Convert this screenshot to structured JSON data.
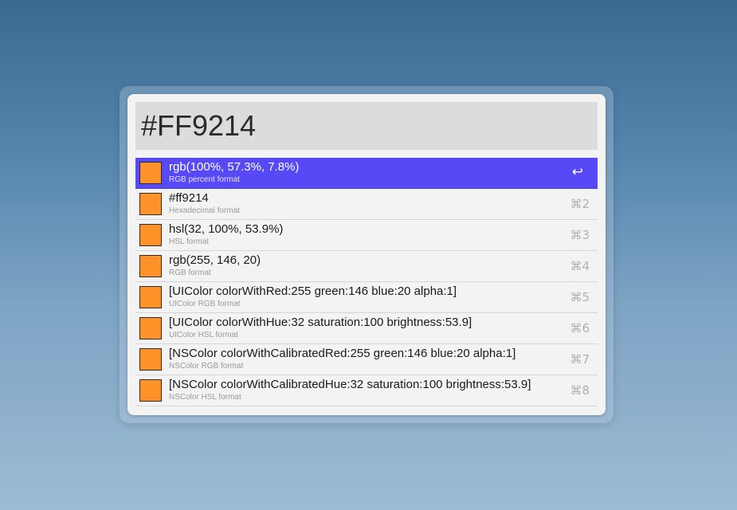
{
  "query": {
    "value": "#FF9214"
  },
  "colors": {
    "swatch": "#ff9229",
    "selection": "#5749f6"
  },
  "results": [
    {
      "title": "rgb(100%, 57.3%, 7.8%)",
      "subtitle": "RGB percent format",
      "shortcut": "↩",
      "selected": true
    },
    {
      "title": "#ff9214",
      "subtitle": "Hexadecimal format",
      "shortcut": "⌘2",
      "selected": false
    },
    {
      "title": "hsl(32, 100%, 53.9%)",
      "subtitle": "HSL format",
      "shortcut": "⌘3",
      "selected": false
    },
    {
      "title": "rgb(255, 146, 20)",
      "subtitle": "RGB format",
      "shortcut": "⌘4",
      "selected": false
    },
    {
      "title": "[UIColor colorWithRed:255 green:146 blue:20 alpha:1]",
      "subtitle": "UIColor RGB format",
      "shortcut": "⌘5",
      "selected": false
    },
    {
      "title": "[UIColor colorWithHue:32 saturation:100 brightness:53.9]",
      "subtitle": "UIColor HSL format",
      "shortcut": "⌘6",
      "selected": false
    },
    {
      "title": "[NSColor colorWithCalibratedRed:255 green:146 blue:20 alpha:1]",
      "subtitle": "NSColor RGB format",
      "shortcut": "⌘7",
      "selected": false
    },
    {
      "title": "[NSColor colorWithCalibratedHue:32 saturation:100 brightness:53.9]",
      "subtitle": "NSColor HSL format",
      "shortcut": "⌘8",
      "selected": false
    }
  ]
}
